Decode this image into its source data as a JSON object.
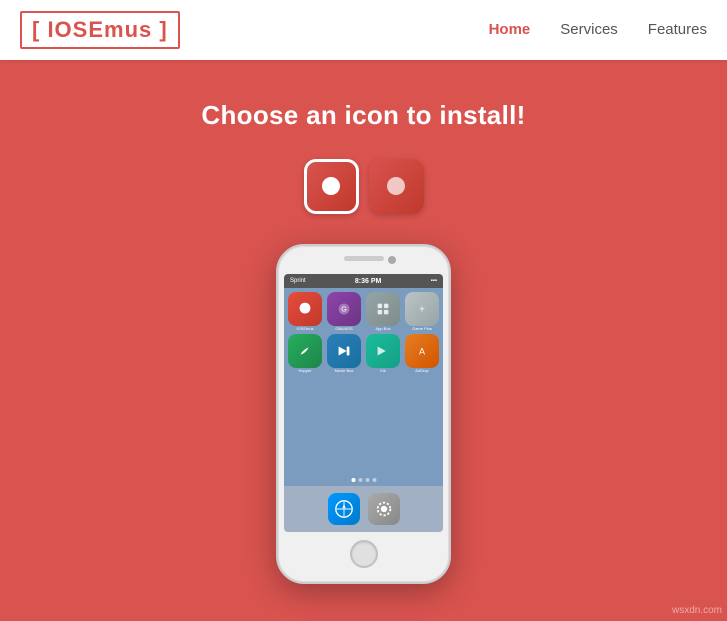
{
  "navbar": {
    "logo": "[ IOSEmus ]",
    "links": [
      {
        "label": "Home",
        "active": true
      },
      {
        "label": "Services",
        "active": false
      },
      {
        "label": "Features",
        "active": false
      }
    ]
  },
  "main": {
    "title": "Choose an icon to install!",
    "icons": [
      {
        "id": "icon-1",
        "style": "red",
        "selected": true
      },
      {
        "id": "icon-2",
        "style": "red",
        "selected": false
      }
    ]
  },
  "phone": {
    "status": {
      "carrier": "Sprint",
      "time": "8:36 PM",
      "icons": "●●●"
    },
    "apps": [
      {
        "label": "IOSEmus",
        "color": "red"
      },
      {
        "label": "GBA4iOS",
        "color": "purple"
      },
      {
        "label": "App Box",
        "color": "gray"
      },
      {
        "label": "Game Plus",
        "color": "light-gray"
      },
      {
        "label": "Hopper",
        "color": "green-bird"
      },
      {
        "label": "Movie Box",
        "color": "blue"
      },
      {
        "label": "Kik",
        "color": "teal"
      },
      {
        "label": "AirDrop",
        "color": "orange"
      }
    ],
    "dock": [
      {
        "label": "Safari",
        "color": "safari"
      },
      {
        "label": "Settings",
        "color": "settings"
      }
    ]
  },
  "watermark": "wsxdn.com"
}
